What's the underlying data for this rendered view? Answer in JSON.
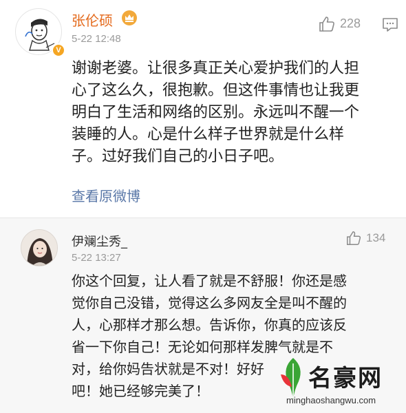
{
  "main_comment": {
    "author": "张伦硕",
    "verified_badge": "V",
    "time": "5-22 12:48",
    "like_count": "228",
    "lines": [
      "谢谢老婆。让很多真正关心爱护我们的人担",
      "心了这么久，很抱歉。但这件事情也让我更",
      "明白了生活和网络的区别。永远叫不醒一个",
      "装睡的人。心是什么样子世界就是什么样",
      "子。过好我们自己的小日子吧。"
    ],
    "view_original": "查看原微博"
  },
  "reply_comment": {
    "author": "伊斓尘秀_",
    "time": "5-22 13:27",
    "like_count": "134",
    "lines": [
      "你这个回复，让人看了就是不舒服！你还是感",
      "觉你自己没错，觉得这么多网友全是叫不醒的",
      "人，心那样才那么想。告诉你，你真的应该反",
      "省一下你自己！无论如何那样发脾气就是不",
      "对，给你妈告状就是不对！好好",
      "吧！她已经够完美了！"
    ]
  },
  "watermark": {
    "title": "名豪网",
    "url": "minghaoshangwu.com"
  },
  "icons": {
    "like": "thumbs-up-icon",
    "comment": "comment-icon",
    "crown": "crown-icon"
  },
  "colors": {
    "author_orange": "#e46a1c",
    "link_blue": "#5a78a8",
    "meta_gray": "#9a9a9a",
    "badge_gold": "#f5a623",
    "watermark_green": "#3aa535",
    "watermark_red": "#e8343a"
  }
}
